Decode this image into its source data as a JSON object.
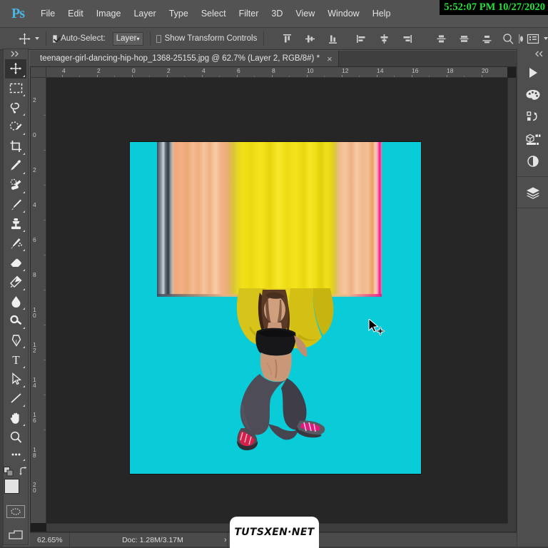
{
  "app": {
    "name": "Adobe Photoshop",
    "logo_text": "Ps",
    "accent_color": "#4ab5e3"
  },
  "menubar": {
    "items": [
      "File",
      "Edit",
      "Image",
      "Layer",
      "Type",
      "Select",
      "Filter",
      "3D",
      "View",
      "Window",
      "Help"
    ],
    "clock": "5:52:07 PM 10/27/2020",
    "clock_color": "#25e03a",
    "clock_bg": "#000000"
  },
  "options_bar": {
    "tool_icon": "move-tool-icon",
    "auto_select_label": "Auto-Select:",
    "auto_select_checked": true,
    "auto_select_target": "Layer",
    "show_transform_label": "Show Transform Controls",
    "show_transform_checked": false,
    "align_icons": [
      "align-top-edges-icon",
      "align-vertical-centers-icon",
      "align-bottom-edges-icon",
      "align-left-edges-icon",
      "align-horizontal-centers-icon",
      "align-right-edges-icon"
    ],
    "distribute_icons": [
      "distribute-top-edges-icon",
      "distribute-vertical-centers-icon",
      "distribute-bottom-edges-icon"
    ],
    "search_icon": "search-icon",
    "workspace_icon": "workspace-switcher-icon"
  },
  "document": {
    "tab_title": "teenager-girl-dancing-hip-hop_1368-25155.jpg @ 62.7% (Layer 2, RGB/8#) *",
    "close_label": "×",
    "zoom_display": "62.7%",
    "layer_name": "Layer 2",
    "color_mode": "RGB/8#",
    "modified": true
  },
  "rulers": {
    "horizontal": [
      "4",
      "2",
      "0",
      "2",
      "4",
      "6",
      "8",
      "10",
      "12",
      "14",
      "16",
      "18",
      "20"
    ],
    "vertical": [
      "2",
      "0",
      "2",
      "4",
      "6",
      "8",
      "10",
      "12",
      "14",
      "16",
      "18",
      "20"
    ],
    "units": "inches"
  },
  "toolbar": {
    "collapse_icon": "collapse-panel-icon",
    "tools": [
      {
        "name": "move-tool",
        "label": "Move Tool",
        "active": true,
        "has_flyout": true
      },
      {
        "name": "rectangular-marquee-tool",
        "label": "Rectangular Marquee Tool",
        "active": false,
        "has_flyout": true
      },
      {
        "name": "lasso-tool",
        "label": "Lasso Tool",
        "active": false,
        "has_flyout": true
      },
      {
        "name": "quick-selection-tool",
        "label": "Quick Selection Tool",
        "active": false,
        "has_flyout": true
      },
      {
        "name": "crop-tool",
        "label": "Crop Tool",
        "active": false,
        "has_flyout": true
      },
      {
        "name": "eyedropper-tool",
        "label": "Eyedropper Tool",
        "active": false,
        "has_flyout": true
      },
      {
        "name": "spot-healing-brush-tool",
        "label": "Spot Healing Brush Tool",
        "active": false,
        "has_flyout": true
      },
      {
        "name": "brush-tool",
        "label": "Brush Tool",
        "active": false,
        "has_flyout": true
      },
      {
        "name": "clone-stamp-tool",
        "label": "Clone Stamp Tool",
        "active": false,
        "has_flyout": true
      },
      {
        "name": "history-brush-tool",
        "label": "History Brush Tool",
        "active": false,
        "has_flyout": true
      },
      {
        "name": "eraser-tool",
        "label": "Eraser Tool",
        "active": false,
        "has_flyout": true
      },
      {
        "name": "gradient-tool",
        "label": "Gradient Tool",
        "active": false,
        "has_flyout": true
      },
      {
        "name": "blur-tool",
        "label": "Blur Tool",
        "active": false,
        "has_flyout": true
      },
      {
        "name": "dodge-tool",
        "label": "Dodge Tool",
        "active": false,
        "has_flyout": true
      },
      {
        "name": "pen-tool",
        "label": "Pen Tool",
        "active": false,
        "has_flyout": true
      },
      {
        "name": "type-tool",
        "label": "Horizontal Type Tool",
        "active": false,
        "has_flyout": true
      },
      {
        "name": "path-selection-tool",
        "label": "Path Selection Tool",
        "active": false,
        "has_flyout": true
      },
      {
        "name": "line-tool",
        "label": "Line Tool",
        "active": false,
        "has_flyout": true
      },
      {
        "name": "hand-tool",
        "label": "Hand Tool",
        "active": false,
        "has_flyout": true
      },
      {
        "name": "zoom-tool",
        "label": "Zoom Tool",
        "active": false,
        "has_flyout": false
      },
      {
        "name": "edit-toolbar",
        "label": "Edit Toolbar",
        "active": false,
        "has_flyout": true
      }
    ],
    "foreground_color": "#e3e3e3",
    "background_color": "#e9e9e9",
    "swap_icon": "swap-colors-icon",
    "default_colors_icon": "default-colors-icon",
    "quick_mask_icon": "quick-mask-icon",
    "screen_mode_icon": "screen-mode-icon"
  },
  "right_panel": {
    "collapse_icon": "expand-panels-icon",
    "icons": [
      {
        "name": "libraries-play-icon",
        "label": "Libraries"
      },
      {
        "name": "color-palette-icon",
        "label": "Color"
      },
      {
        "name": "history-icon",
        "label": "History"
      },
      {
        "name": "properties-3d-icon",
        "label": "Properties"
      },
      {
        "name": "adjustments-icon",
        "label": "Adjustments"
      },
      {
        "name": "layers-icon",
        "label": "Layers"
      }
    ]
  },
  "canvas": {
    "background_color": "#0accd9",
    "artboard_label": "image-canvas",
    "effect": "vertical-pixel-stretch",
    "cursor": "move-cursor",
    "subject": "dancer-silhouette"
  },
  "status_bar": {
    "zoom": "62.65%",
    "doc_info": "Doc: 1.28M/3.17M",
    "expand_arrow": "›"
  },
  "watermark": {
    "text": "TUTSXEN·NET"
  }
}
